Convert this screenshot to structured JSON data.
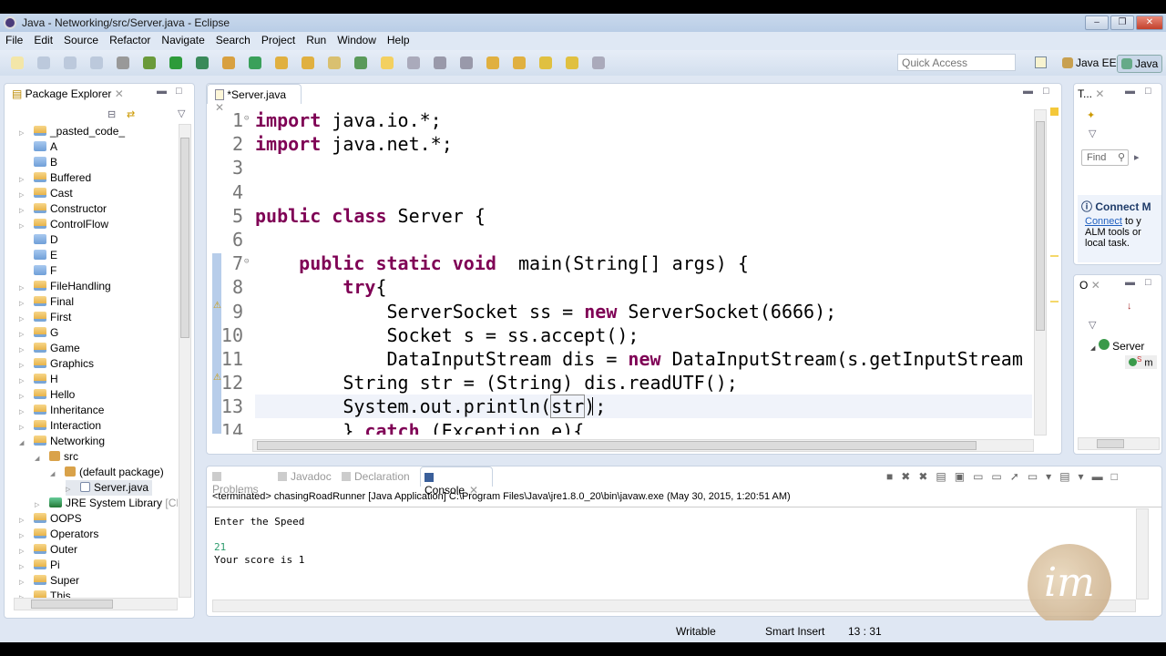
{
  "window": {
    "title": "Java - Networking/src/Server.java - Eclipse"
  },
  "menu": [
    "File",
    "Edit",
    "Source",
    "Refactor",
    "Navigate",
    "Search",
    "Project",
    "Run",
    "Window",
    "Help"
  ],
  "toolbar": {
    "quick_access_placeholder": "Quick Access",
    "perspectives": [
      "Java EE",
      "Java"
    ]
  },
  "package_explorer": {
    "title": "Package Explorer",
    "items": [
      {
        "label": "_pasted_code_",
        "level": 0,
        "icon": "project",
        "expand": "closed"
      },
      {
        "label": "A",
        "level": 0,
        "icon": "folder",
        "expand": "none"
      },
      {
        "label": "B",
        "level": 0,
        "icon": "folder",
        "expand": "none"
      },
      {
        "label": "Buffered",
        "level": 0,
        "icon": "project",
        "expand": "closed"
      },
      {
        "label": "Cast",
        "level": 0,
        "icon": "project",
        "expand": "closed"
      },
      {
        "label": "Constructor",
        "level": 0,
        "icon": "project",
        "expand": "closed"
      },
      {
        "label": "ControlFlow",
        "level": 0,
        "icon": "project",
        "expand": "closed"
      },
      {
        "label": "D",
        "level": 0,
        "icon": "folder",
        "expand": "none"
      },
      {
        "label": "E",
        "level": 0,
        "icon": "folder",
        "expand": "none"
      },
      {
        "label": "F",
        "level": 0,
        "icon": "folder",
        "expand": "none"
      },
      {
        "label": "FileHandling",
        "level": 0,
        "icon": "project",
        "expand": "closed"
      },
      {
        "label": "Final",
        "level": 0,
        "icon": "project",
        "expand": "closed"
      },
      {
        "label": "First",
        "level": 0,
        "icon": "project",
        "expand": "closed"
      },
      {
        "label": "G",
        "level": 0,
        "icon": "project",
        "expand": "closed"
      },
      {
        "label": "Game",
        "level": 0,
        "icon": "project",
        "expand": "closed"
      },
      {
        "label": "Graphics",
        "level": 0,
        "icon": "project",
        "expand": "closed"
      },
      {
        "label": "H",
        "level": 0,
        "icon": "project",
        "expand": "closed"
      },
      {
        "label": "Hello",
        "level": 0,
        "icon": "project",
        "expand": "closed"
      },
      {
        "label": "Inheritance",
        "level": 0,
        "icon": "project",
        "expand": "closed"
      },
      {
        "label": "Interaction",
        "level": 0,
        "icon": "project",
        "expand": "closed"
      },
      {
        "label": "Networking",
        "level": 0,
        "icon": "project",
        "expand": "open"
      },
      {
        "label": "src",
        "level": 1,
        "icon": "package",
        "expand": "open"
      },
      {
        "label": "(default package)",
        "level": 2,
        "icon": "package",
        "expand": "open"
      },
      {
        "label": "Server.java",
        "level": 3,
        "icon": "java",
        "expand": "closed",
        "selected": true
      },
      {
        "label": "JRE System Library",
        "suffix": "[CDC-",
        "level": 1,
        "icon": "library",
        "expand": "closed"
      },
      {
        "label": "OOPS",
        "level": 0,
        "icon": "project",
        "expand": "closed"
      },
      {
        "label": "Operators",
        "level": 0,
        "icon": "project",
        "expand": "closed"
      },
      {
        "label": "Outer",
        "level": 0,
        "icon": "project",
        "expand": "closed"
      },
      {
        "label": "Pi",
        "level": 0,
        "icon": "project",
        "expand": "closed"
      },
      {
        "label": "Super",
        "level": 0,
        "icon": "project",
        "expand": "closed"
      },
      {
        "label": "This",
        "level": 0,
        "icon": "project",
        "expand": "closed"
      }
    ]
  },
  "editor": {
    "tab": "*Server.java",
    "lines": [
      [
        {
          "t": "import",
          "k": "kw"
        },
        {
          "t": " java.io.*;"
        }
      ],
      [
        {
          "t": "import",
          "k": "kw"
        },
        {
          "t": " java.net.*;"
        }
      ],
      [],
      [],
      [
        {
          "t": "public",
          "k": "kw"
        },
        {
          "t": " "
        },
        {
          "t": "class",
          "k": "kw"
        },
        {
          "t": " Server {"
        }
      ],
      [],
      [
        {
          "t": "    "
        },
        {
          "t": "public",
          "k": "kw"
        },
        {
          "t": " "
        },
        {
          "t": "static",
          "k": "kw"
        },
        {
          "t": " "
        },
        {
          "t": "void",
          "k": "kw"
        },
        {
          "t": "  main(String[] args) {"
        }
      ],
      [
        {
          "t": "        "
        },
        {
          "t": "try",
          "k": "kw"
        },
        {
          "t": "{"
        }
      ],
      [
        {
          "t": "            ServerSocket ss = "
        },
        {
          "t": "new",
          "k": "kw"
        },
        {
          "t": " ServerSocket(6666);"
        }
      ],
      [
        {
          "t": "            Socket s = ss.accept();"
        }
      ],
      [
        {
          "t": "            DataInputStream dis = "
        },
        {
          "t": "new",
          "k": "kw"
        },
        {
          "t": " DataInputStream(s.getInputStream"
        }
      ],
      [
        {
          "t": "        String str = (String) dis.readUTF();"
        }
      ],
      [
        {
          "t": "        System.out.println("
        },
        {
          "t": "str",
          "k": "link"
        },
        {
          "t": ");"
        }
      ],
      [
        {
          "t": "        } "
        },
        {
          "t": "catch",
          "k": "kw"
        },
        {
          "t": " (Exception e){"
        }
      ]
    ]
  },
  "task_list": {
    "tab": "T...",
    "find_placeholder": "Find",
    "connect_title": "Connect M",
    "connect_link": "Connect",
    "connect_text": " to y",
    "connect_text2": "ALM tools or",
    "connect_text3": "local task."
  },
  "outline": {
    "tab": "O",
    "class": "Server",
    "member": "m",
    "member_badge": "S"
  },
  "console": {
    "tabs": [
      "Problems",
      "Javadoc",
      "Declaration",
      "Console"
    ],
    "active": "Console",
    "header": "<terminated> chasingRoadRunner [Java Application] C:\\Program Files\\Java\\jre1.8.0_20\\bin\\javaw.exe (May 30, 2015, 1:20:51 AM)",
    "output": [
      "Enter the Speed",
      "",
      "21",
      "Your score is 1"
    ]
  },
  "status": {
    "writable": "Writable",
    "insert_mode": "Smart Insert",
    "position": "13 : 31"
  },
  "watermark": "im",
  "colors": {
    "keyword": "#7f0055",
    "input": "#2e9c6e"
  }
}
